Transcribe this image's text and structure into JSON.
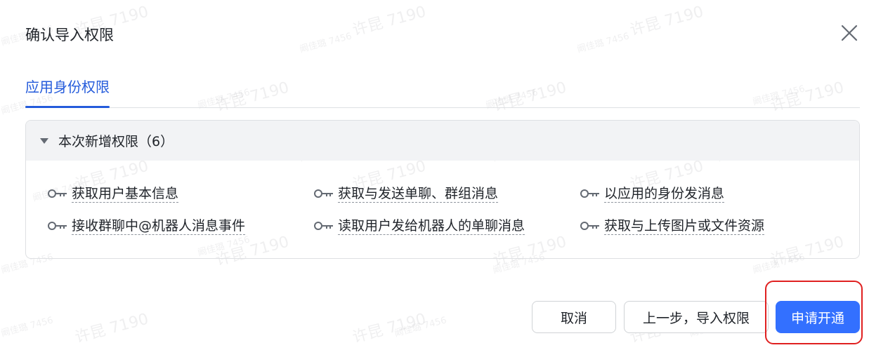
{
  "dialog": {
    "title": "确认导入权限",
    "tab_label": "应用身份权限"
  },
  "section": {
    "title": "本次新增权限（6）"
  },
  "permissions": [
    "获取用户基本信息",
    "获取与发送单聊、群组消息",
    "以应用的身份发消息",
    "接收群聊中@机器人消息事件",
    "读取用户发给机器人的单聊消息",
    "获取与上传图片或文件资源"
  ],
  "buttons": {
    "cancel": "取消",
    "prev": "上一步，导入权限",
    "apply": "申请开通"
  },
  "watermark": {
    "name_large": "许昆 7190",
    "name_small": "阚佳璐 7456"
  },
  "colors": {
    "accent": "#3370ff",
    "tab_active": "#245bdb",
    "highlight": "#e02020"
  }
}
